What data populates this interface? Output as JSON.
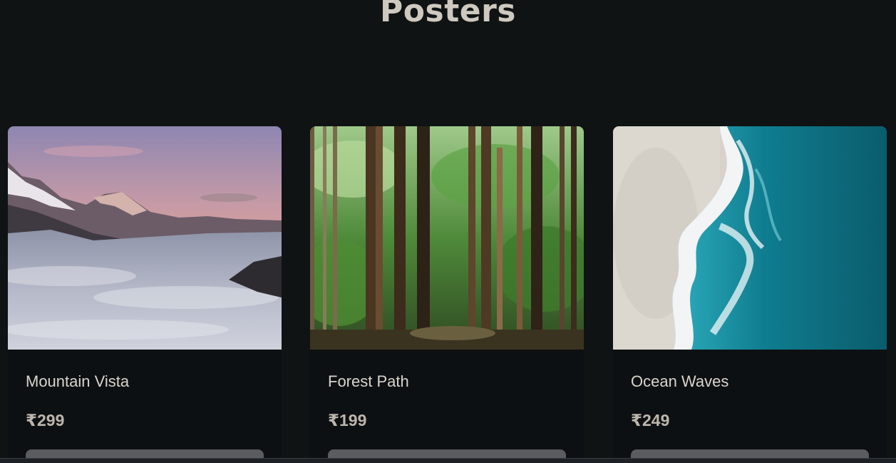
{
  "header": {
    "title": "Posters"
  },
  "products": [
    {
      "title": "Mountain Vista",
      "price": "₹299",
      "image_icon": "mountain-photo"
    },
    {
      "title": "Forest Path",
      "price": "₹199",
      "image_icon": "forest-photo"
    },
    {
      "title": "Ocean Waves",
      "price": "₹249",
      "image_icon": "ocean-photo"
    }
  ],
  "colors": {
    "background": "#0f1314",
    "card": "#0d1012",
    "title_text": "#cfc8be",
    "button": "#5a5c60"
  }
}
